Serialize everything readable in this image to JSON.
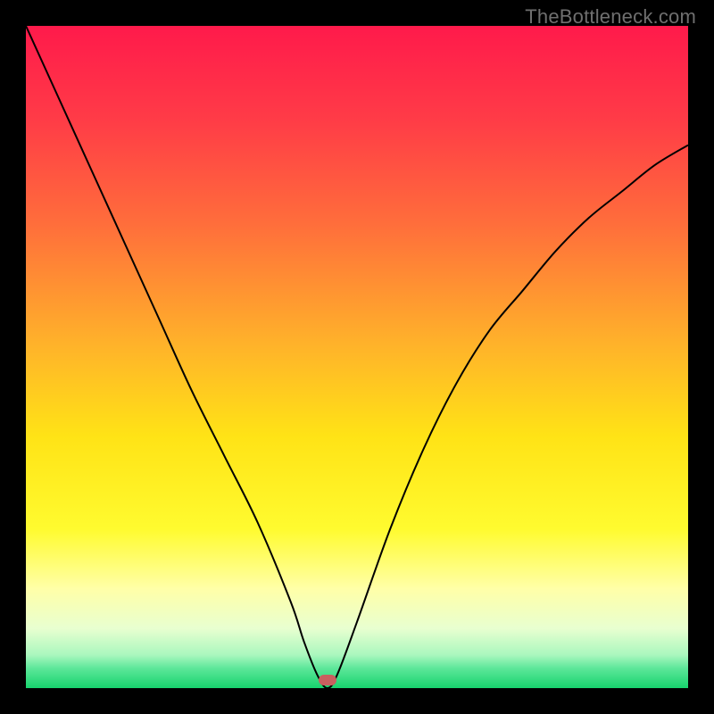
{
  "watermark": {
    "text": "TheBottleneck.com"
  },
  "chart_data": {
    "type": "line",
    "title": "",
    "xlabel": "",
    "ylabel": "",
    "xlim": [
      0,
      100
    ],
    "ylim": [
      0,
      100
    ],
    "grid": false,
    "legend": false,
    "background_gradient": {
      "stops": [
        {
          "pct": 0,
          "color": "#ff1a4b"
        },
        {
          "pct": 14,
          "color": "#ff3b47"
        },
        {
          "pct": 30,
          "color": "#ff6e3b"
        },
        {
          "pct": 48,
          "color": "#ffb22a"
        },
        {
          "pct": 62,
          "color": "#ffe316"
        },
        {
          "pct": 76,
          "color": "#fffb2f"
        },
        {
          "pct": 85,
          "color": "#ffffa8"
        },
        {
          "pct": 91,
          "color": "#e8ffd0"
        },
        {
          "pct": 95,
          "color": "#aaf7be"
        },
        {
          "pct": 97,
          "color": "#5de79a"
        },
        {
          "pct": 100,
          "color": "#17d36d"
        }
      ]
    },
    "series": [
      {
        "name": "bottleneck-curve",
        "color": "#000000",
        "x": [
          0,
          5,
          10,
          15,
          20,
          25,
          30,
          35,
          40,
          42,
          44,
          45.5,
          47,
          50,
          55,
          60,
          65,
          70,
          75,
          80,
          85,
          90,
          95,
          100
        ],
        "y": [
          100,
          89,
          78,
          67,
          56,
          45,
          35,
          25,
          13,
          7,
          2,
          0,
          2,
          10,
          24,
          36,
          46,
          54,
          60,
          66,
          71,
          75,
          79,
          82
        ]
      }
    ],
    "marker": {
      "x": 45.5,
      "y": 1.2,
      "color": "#c9605f"
    }
  }
}
